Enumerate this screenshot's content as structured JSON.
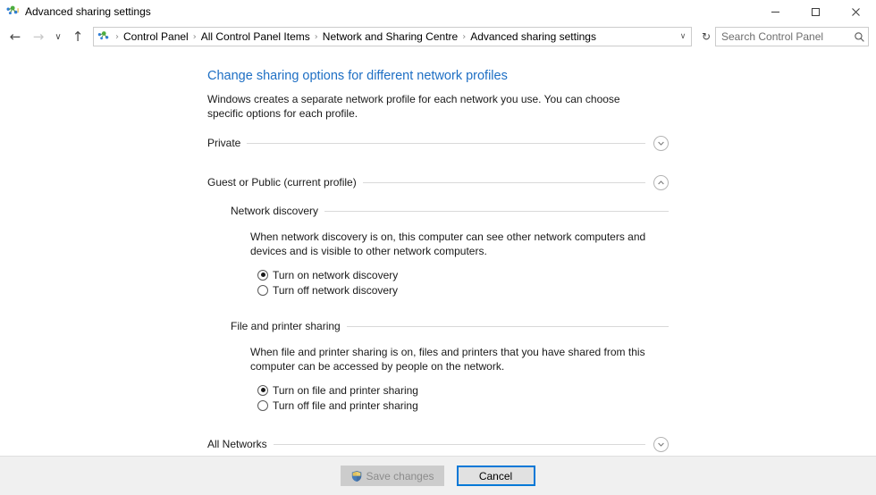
{
  "window": {
    "title": "Advanced sharing settings",
    "icon": "network-sharing-icon",
    "minimize_label": "─",
    "maximize_label": "☐",
    "close_label": "✕"
  },
  "navbar": {
    "back_label": "←",
    "forward_label": "→",
    "recent_label": "∨",
    "up_label": "↑",
    "breadcrumbs": [
      "Control Panel",
      "All Control Panel Items",
      "Network and Sharing Centre",
      "Advanced sharing settings"
    ],
    "separator": "›",
    "dropdown_label": "∨",
    "refresh_label": "↻",
    "search": {
      "placeholder": "Search Control Panel",
      "value": "",
      "icon": "search-icon"
    }
  },
  "page": {
    "title": "Change sharing options for different network profiles",
    "description": "Windows creates a separate network profile for each network you use. You can choose specific options for each profile."
  },
  "profiles": [
    {
      "label": "Private",
      "expanded": false,
      "chevron": "chevron-down-icon"
    },
    {
      "label": "Guest or Public (current profile)",
      "expanded": true,
      "chevron": "chevron-up-icon"
    },
    {
      "label": "All Networks",
      "expanded": false,
      "chevron": "chevron-down-icon"
    }
  ],
  "sections": [
    {
      "label": "Network discovery",
      "description": "When network discovery is on, this computer can see other network computers and devices and is visible to other network computers.",
      "options": [
        {
          "label": "Turn on network discovery",
          "selected": true
        },
        {
          "label": "Turn off network discovery",
          "selected": false
        }
      ]
    },
    {
      "label": "File and printer sharing",
      "description": "When file and printer sharing is on, files and printers that you have shared from this computer can be accessed by people on the network.",
      "options": [
        {
          "label": "Turn on file and printer sharing",
          "selected": true
        },
        {
          "label": "Turn off file and printer sharing",
          "selected": false
        }
      ]
    }
  ],
  "footer": {
    "save_label": "Save changes",
    "save_disabled": true,
    "save_icon": "uac-shield-icon",
    "cancel_label": "Cancel",
    "cancel_focused": true
  },
  "colors": {
    "heading_blue": "#1e6fc4",
    "focus_blue": "#0078d7",
    "footer_bg": "#f0f0f0",
    "rule": "#d9d9d9"
  }
}
